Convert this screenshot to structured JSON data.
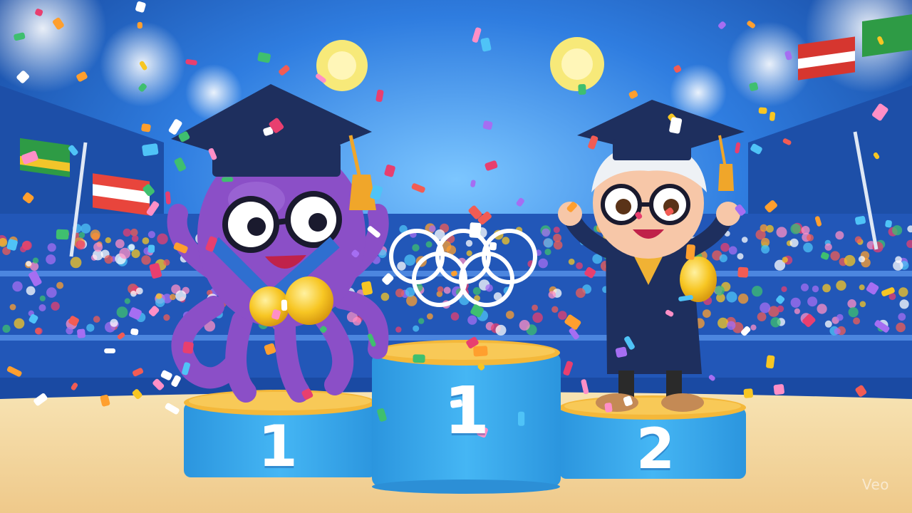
{
  "podium": {
    "left_place": "1",
    "center_place": "1",
    "right_place": "2"
  },
  "watermark": "Veo",
  "characters": [
    {
      "name": "octopus-graduate",
      "color": "#8b4fc7"
    },
    {
      "name": "child-graduate",
      "color": "#1e2f5e"
    }
  ],
  "colors": {
    "sky": "#2f7de0",
    "podium": "#39a9ef",
    "podium_top": "#f4b83a",
    "floor": "#f3d79c",
    "gold_medal": "#f7c623"
  }
}
